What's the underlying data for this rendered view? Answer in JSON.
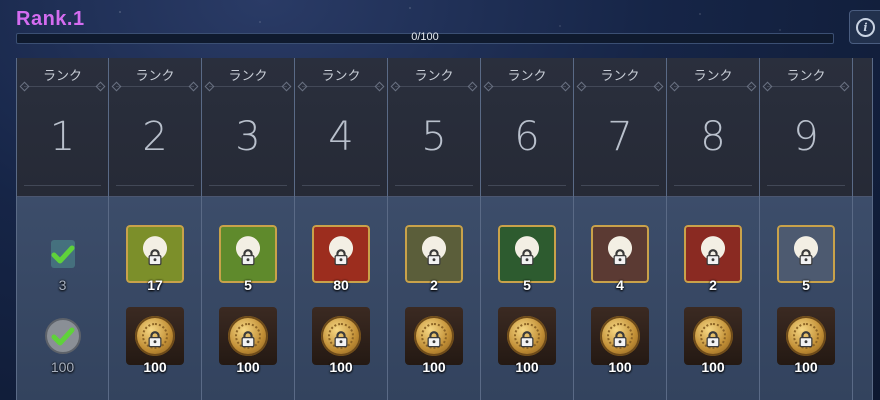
{
  "header": {
    "title": "Rank.1",
    "progress_text": "0/100",
    "progress_value": 0.0
  },
  "info_icon": "info-icon",
  "columns": [
    {
      "label": "ランク",
      "number": "1",
      "reward_count": "3",
      "coin_count": "100",
      "claimed": true,
      "reward_icon": "check-box-icon",
      "reward_color": "#30586b"
    },
    {
      "label": "ランク",
      "number": "2",
      "reward_count": "17",
      "coin_count": "100",
      "claimed": false,
      "reward_icon": "stone-fragment-icon",
      "reward_color": "#7c8f2a"
    },
    {
      "label": "ランク",
      "number": "3",
      "reward_count": "5",
      "coin_count": "100",
      "claimed": false,
      "reward_icon": "stone-fragment-icon",
      "reward_color": "#5f8a2c"
    },
    {
      "label": "ランク",
      "number": "4",
      "reward_count": "80",
      "coin_count": "100",
      "claimed": false,
      "reward_icon": "eye-emblem-icon",
      "reward_color": "#9c2d1e"
    },
    {
      "label": "ランク",
      "number": "5",
      "reward_count": "2",
      "coin_count": "100",
      "claimed": false,
      "reward_icon": "ring-charm-icon",
      "reward_color": "#5b5e3a"
    },
    {
      "label": "ランク",
      "number": "6",
      "reward_count": "5",
      "coin_count": "100",
      "claimed": false,
      "reward_icon": "hex-stone-icon",
      "reward_color": "#2d5b2f"
    },
    {
      "label": "ランク",
      "number": "7",
      "reward_count": "4",
      "coin_count": "100",
      "claimed": false,
      "reward_icon": "leaf-charm-icon",
      "reward_color": "#5b3a33"
    },
    {
      "label": "ランク",
      "number": "8",
      "reward_count": "2",
      "coin_count": "100",
      "claimed": false,
      "reward_icon": "treasure-chest-icon",
      "reward_color": "#8a2a22"
    },
    {
      "label": "ランク",
      "number": "9",
      "reward_count": "5",
      "coin_count": "100",
      "claimed": false,
      "reward_icon": "star-bow-icon",
      "reward_color": "#4d5a70"
    }
  ],
  "colors": {
    "title": "#d46cf0",
    "progress_fill": "#5fa7ff",
    "check": "#5fd23a"
  }
}
